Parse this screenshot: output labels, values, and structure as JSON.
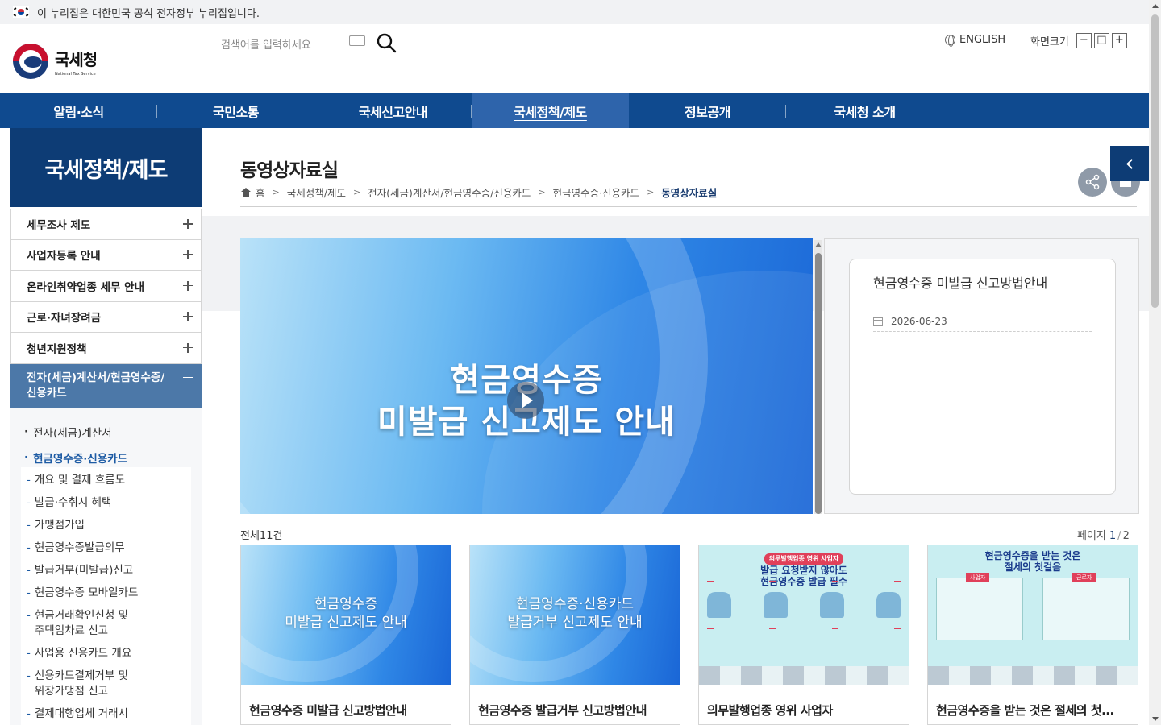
{
  "gov_banner": {
    "text": "이 누리집은 대한민국 공식 전자정부 누리집입니다."
  },
  "header": {
    "logo_kr": "국세청",
    "logo_en": "National Tax Service",
    "search_placeholder": "검색어를 입력하세요",
    "lang": "ENGLISH",
    "zoom_label": "화면크기",
    "zoom_minus": "−",
    "zoom_reset": "□",
    "zoom_plus": "+"
  },
  "gnb": {
    "items": [
      {
        "label": "알림·소식"
      },
      {
        "label": "국민소통"
      },
      {
        "label": "국세신고안내"
      },
      {
        "label": "국세정책/제도",
        "active": true
      },
      {
        "label": "정보공개"
      },
      {
        "label": "국세청 소개"
      }
    ]
  },
  "lnb": {
    "title": "국세정책/제도",
    "items": [
      {
        "label": "세무조사 제도"
      },
      {
        "label": "사업자등록 안내"
      },
      {
        "label": "온라인취약업종 세무 안내"
      },
      {
        "label": "근로·자녀장려금"
      },
      {
        "label": "청년지원정책"
      },
      {
        "label_line1": "전자(세금)계산서/현금영수증/",
        "label_line2": "신용카드"
      }
    ],
    "sub2": [
      {
        "label": "전자(세금)계산서"
      },
      {
        "label": "현금영수증·신용카드"
      }
    ],
    "sub3": [
      {
        "line1": "개요 및 결제 흐름도"
      },
      {
        "line1": "발급·수취시 혜택"
      },
      {
        "line1": "가맹점가입"
      },
      {
        "line1": "현금영수증발급의무"
      },
      {
        "line1": "발급거부(미발급)신고"
      },
      {
        "line1": "현금영수증 모바일카드"
      },
      {
        "line1": "현금거래확인신청 및",
        "line2": "주택임차료 신고"
      },
      {
        "line1": "사업용 신용카드 개요"
      },
      {
        "line1": "신용카드결제거부 및",
        "line2": "위장가맹점 신고"
      },
      {
        "line1": "결제대행업체 거래시"
      }
    ]
  },
  "content": {
    "title": "동영상자료실",
    "breadcrumb": [
      "홈",
      "국세정책/제도",
      "전자(세금)계산서/현금영수증/신용카드",
      "현금영수증·신용카드",
      "동영상자료실"
    ],
    "video": {
      "line1": "현금영수증",
      "line2": "미발급 신고제도 안내"
    },
    "info": {
      "title": "현금영수증 미발급 신고방법안내",
      "date": "2026-06-23"
    },
    "total_label": "전체",
    "total_count": "11건",
    "page_label": "페이지",
    "page_current": "1",
    "page_sep": "/",
    "page_total": "2",
    "cards": [
      {
        "thumb_line1": "현금영수증",
        "thumb_line2": "미발급 신고제도 안내",
        "title": "현금영수증 미발급 신고방법안내"
      },
      {
        "thumb_line1": "현금영수증·신용카드",
        "thumb_line2": "발급거부 신고제도 안내",
        "title": "현금영수증 발급거부 신고방법안내"
      },
      {
        "poster_tag": "의무발행업종 영위 사업자",
        "poster_line1": "발급 요청받지 않아도",
        "poster_line2": "현금영수증 발급 필수",
        "title": "의무발행업종 영위 사업자"
      },
      {
        "poster_line1": "현금영수증을 받는 것은",
        "poster_line2": "절세의 첫걸음",
        "left_chip": "사업자",
        "right_chip": "근로자",
        "title": "현금영수증을 받는 것은 절세의 첫..."
      }
    ]
  },
  "colors": {
    "gnb": "#0f4a8f",
    "gnb_active": "#2e64ab",
    "lnb_title": "#0d3c75",
    "lnb_open": "#4c78a8"
  }
}
